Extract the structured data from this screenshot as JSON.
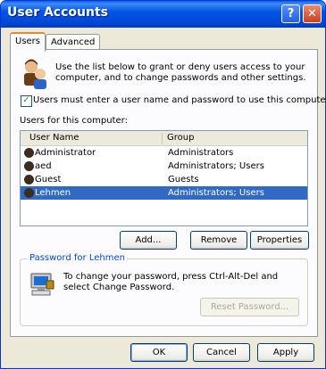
{
  "window": {
    "title": "User Accounts",
    "help_label": "?",
    "close_label": "✕"
  },
  "tabs": [
    {
      "label": "Users"
    },
    {
      "label": "Advanced"
    }
  ],
  "intro_text": "Use the list below to grant or deny users access to your computer, and to change passwords and other settings.",
  "require_login": {
    "label": "Users must enter a user name and password to use this computer.",
    "checked": true,
    "mark": "✓"
  },
  "users_list": {
    "label": "Users for this computer:",
    "columns": [
      "User Name",
      "Group"
    ],
    "rows": [
      {
        "name": "Administrator",
        "group": "Administrators"
      },
      {
        "name": "aed",
        "group": "Administrators; Users"
      },
      {
        "name": "Guest",
        "group": "Guests"
      },
      {
        "name": "Lehmen",
        "group": "Administrators; Users",
        "selected": true
      }
    ]
  },
  "list_buttons": {
    "add": "Add...",
    "remove": "Remove",
    "properties": "Properties"
  },
  "password_group": {
    "title": "Password for Lehmen",
    "text": "To change your password, press Ctrl-Alt-Del and select Change Password.",
    "reset_label": "Reset Password..."
  },
  "dialog_buttons": {
    "ok": "OK",
    "cancel": "Cancel",
    "apply": "Apply"
  },
  "colors": {
    "title_bar": "#0554e3",
    "selection": "#316ac5",
    "dialog_bg": "#ece9d8"
  }
}
